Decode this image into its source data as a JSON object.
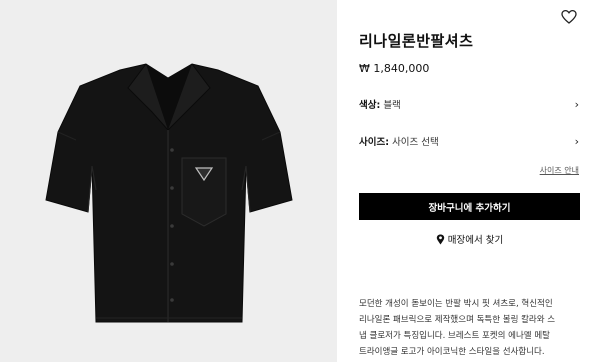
{
  "product": {
    "image_alt": "black short sleeve shirt with enamel triangle logo",
    "title": "리나일론반팔셔츠",
    "price": "₩ 1,840,000"
  },
  "options": {
    "color_label": "색상:",
    "color_value": "블랙",
    "size_label": "사이즈:",
    "size_value": "사이즈 선택",
    "chevron": "›"
  },
  "size_guide": "사이즈 안내",
  "actions": {
    "add_to_cart": "장바구니에 추가하기",
    "find_in_store": "매장에서 찾기"
  },
  "description": {
    "lines": [
      "모던한 개성이 돋보이는 반팔 박시 핏 셔츠로, 혁신적인",
      "리나일론 패브릭으로 제작했으며 독특한 볼링 칼라와 스",
      "냅 클로저가 특징입니다. 브레스트 포켓의 에나멜 메탈",
      "트라이앵글 로고가 아이코닉한 스타일을 선사합니다."
    ]
  },
  "icons": {
    "wishlist": "heart-icon",
    "location": "location-pin-icon"
  },
  "colors": {
    "button_bg": "#000000",
    "button_text": "#ffffff",
    "image_bg": "#eeeeee",
    "shirt": "#131313"
  }
}
